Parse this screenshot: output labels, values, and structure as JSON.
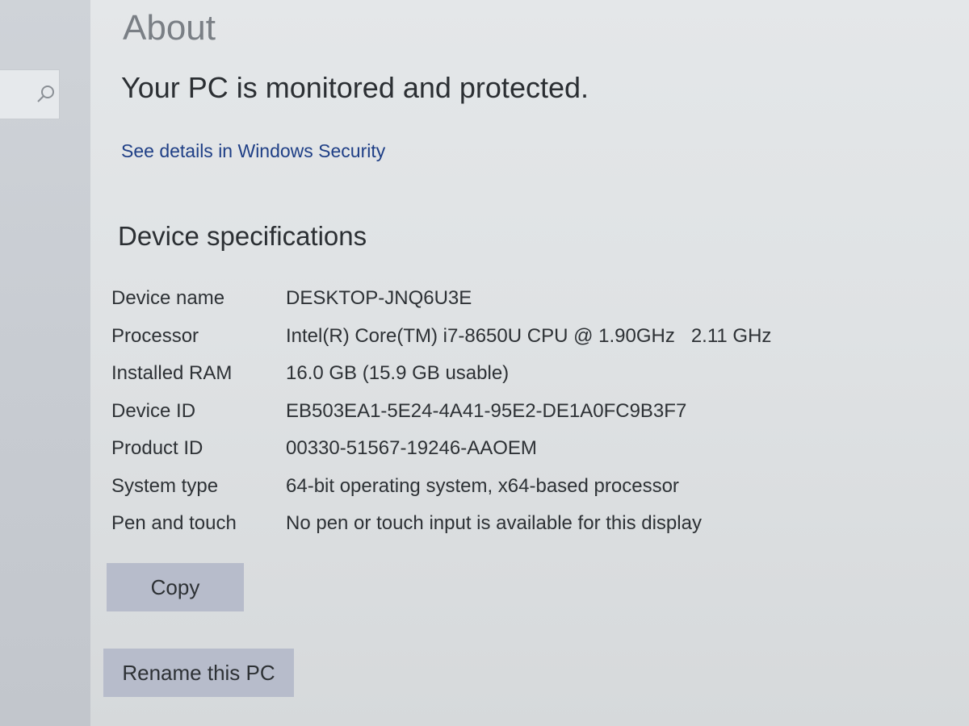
{
  "sidebar": {
    "search_icon": "search-icon"
  },
  "page": {
    "title": "About"
  },
  "security": {
    "status": "Your PC is monitored and protected.",
    "link": "See details in Windows Security"
  },
  "device_specs": {
    "heading": "Device specifications",
    "rows": [
      {
        "label": "Device name",
        "value": "DESKTOP-JNQ6U3E"
      },
      {
        "label": "Processor",
        "value": "Intel(R) Core(TM) i7-8650U CPU @ 1.90GHz   2.11 GHz"
      },
      {
        "label": "Installed RAM",
        "value": "16.0 GB (15.9 GB usable)"
      },
      {
        "label": "Device ID",
        "value": "EB503EA1-5E24-4A41-95E2-DE1A0FC9B3F7"
      },
      {
        "label": "Product ID",
        "value": "00330-51567-19246-AAOEM"
      },
      {
        "label": "System type",
        "value": "64-bit operating system, x64-based processor"
      },
      {
        "label": "Pen and touch",
        "value": "No pen or touch input is available for this display"
      }
    ],
    "copy_label": "Copy"
  },
  "actions": {
    "rename_label": "Rename this PC"
  },
  "colors": {
    "link": "#1f3f86",
    "button_bg": "#b7bccb",
    "background": "#e0e3e5"
  }
}
